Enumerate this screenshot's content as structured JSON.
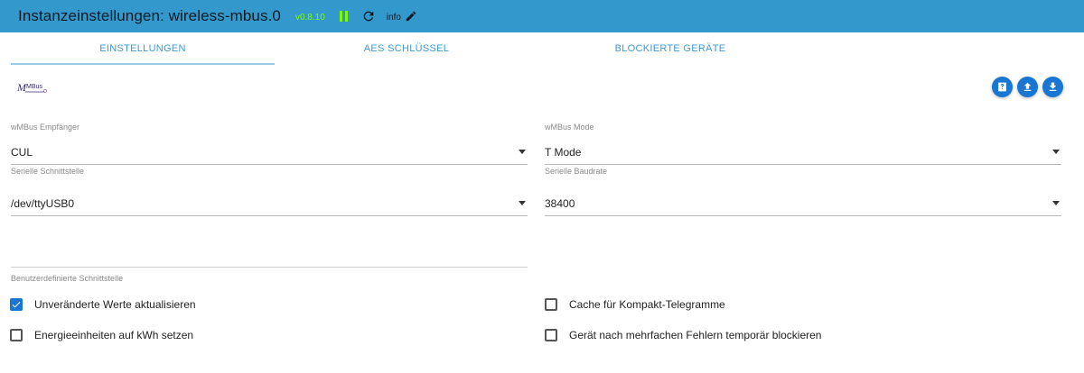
{
  "header": {
    "title": "Instanzeinstellungen: wireless-mbus.0",
    "version": "v0.8.10",
    "info_label": "info"
  },
  "tabs": [
    {
      "label": "EINSTELLUNGEN",
      "active": true
    },
    {
      "label": "AES SCHLÜSSEL",
      "active": false
    },
    {
      "label": "BLOCKIERTE GERÄTE",
      "active": false
    }
  ],
  "logo": {
    "text": "MBus"
  },
  "actions": [
    {
      "icon": "help-icon"
    },
    {
      "icon": "upload-icon"
    },
    {
      "icon": "download-icon"
    }
  ],
  "form": {
    "receiver": {
      "label": "wMBus Empfänger",
      "value": "CUL"
    },
    "mode": {
      "label": "wMBus Mode",
      "value": "T Mode"
    },
    "serial_port": {
      "label": "Serielle Schnittstelle",
      "value": "/dev/ttyUSB0"
    },
    "baudrate": {
      "label": "Serielle Baudrate",
      "value": "38400"
    },
    "custom_port": {
      "label": "Benutzerdefinierte Schnittstelle",
      "value": ""
    }
  },
  "checkboxes": {
    "update_unchanged": {
      "label": "Unveränderte Werte aktualisieren",
      "checked": true
    },
    "cache_compact": {
      "label": "Cache für Kompakt-Telegramme",
      "checked": false
    },
    "energy_kwh": {
      "label": "Energieeinheiten auf kWh setzen",
      "checked": false
    },
    "block_device": {
      "label": "Gerät nach mehrfachen Fehlern temporär blockieren",
      "checked": false
    }
  },
  "colors": {
    "header_bg": "#3399cc",
    "accent": "#1976d2",
    "version": "#7CFC00",
    "tab_text": "#3e99d2"
  }
}
